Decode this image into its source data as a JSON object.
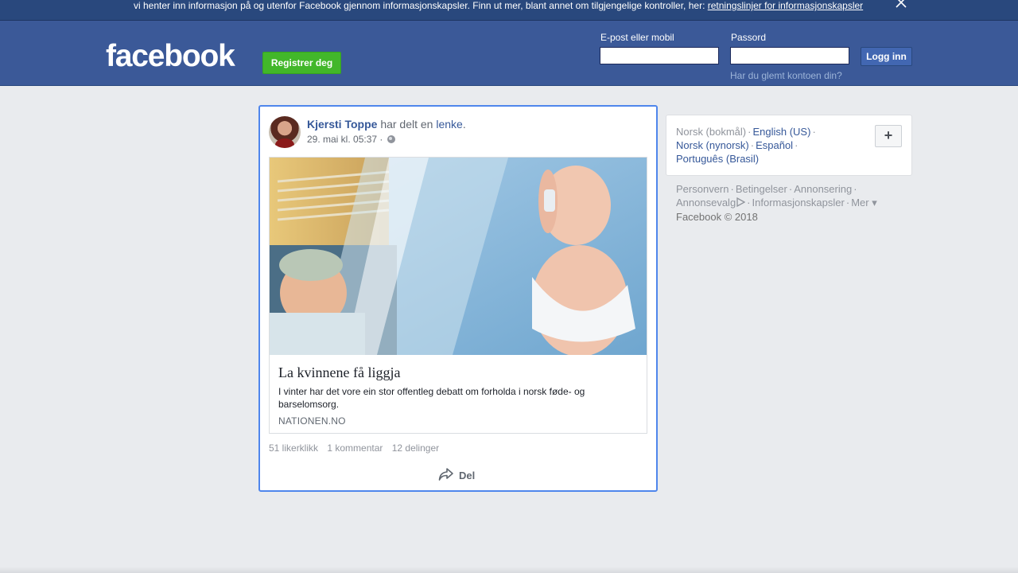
{
  "cookie_banner": {
    "text": "vi henter inn informasjon på og utenfor Facebook gjennom informasjonskapsler. Finn ut mer, blant annet om tilgjengelige kontroller, her: ",
    "link": "retningslinjer for informasjonskapsler",
    "close_icon": "close-icon"
  },
  "header": {
    "logo": "facebook",
    "register_label": "Registrer deg",
    "email_label": "E-post eller mobil",
    "email_value": "",
    "password_label": "Passord",
    "password_value": "",
    "login_label": "Logg inn",
    "forgot_label": "Har du glemt kontoen din?"
  },
  "post": {
    "author": "Kjersti Toppe",
    "action": "har delt en",
    "object": "lenke",
    "period": ".",
    "timestamp": "29. mai kl. 05:37",
    "dot": "·",
    "privacy_icon": "globe-icon",
    "link": {
      "title": "La kvinnene få liggja",
      "description": "I vinter har det vore ein stor offentleg debatt om forholda i norsk føde- og barselomsorg.",
      "domain": "NATIONEN.NO"
    },
    "stats": {
      "likes": "51 likerklikk",
      "comments": "1 kommentar",
      "shares": "12 delinger"
    },
    "share_label": "Del"
  },
  "languages": {
    "current": "Norsk (bokmål)",
    "options": [
      "English (US)",
      "Norsk (nynorsk)",
      "Español",
      "Português (Brasil)"
    ],
    "separator": "·",
    "add_icon": "plus-icon"
  },
  "footer": {
    "links": [
      "Personvern",
      "Betingelser",
      "Annonsering",
      "Annonsevalg",
      "Informasjonskapsler",
      "Mer"
    ],
    "copyright": "Facebook © 2018"
  },
  "colors": {
    "brand_blue": "#3b5998",
    "banner_blue": "#29487d",
    "register_green": "#42b72a",
    "link_blue": "#365899",
    "focus_border": "#4f86ec",
    "page_bg": "#e9ebee"
  }
}
